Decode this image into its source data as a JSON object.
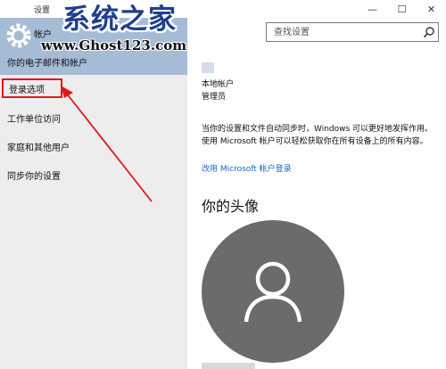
{
  "window": {
    "title": "设置",
    "controls": {
      "minimize": "—",
      "maximize": "☐",
      "close": "✕"
    }
  },
  "header": {
    "page_title": "帐户",
    "gear_icon": "gear-icon"
  },
  "watermark": {
    "title": "系统之家",
    "url": "www.Ghost123.com"
  },
  "sidebar": {
    "items": [
      {
        "label": "你的电子邮件和帐户"
      },
      {
        "label": "登录选项"
      },
      {
        "label": "工作单位访问"
      },
      {
        "label": "家庭和其他用户"
      },
      {
        "label": "同步你的设置"
      }
    ]
  },
  "search": {
    "placeholder": "查找设置",
    "icon": "search-icon"
  },
  "account": {
    "type": "本地帐户",
    "role": "管理员"
  },
  "sync_info": "当你的设置和文件自动同步时，Windows 可以更好地发挥作用。使用 Microsoft 帐户可以轻松获取你在所有设备上的所有内容。",
  "ms_link": "改用 Microsoft 帐户登录",
  "avatar_section": {
    "heading": "你的头像",
    "icon": "user-icon"
  },
  "colors": {
    "header_bg": "#a6bbd6",
    "sidebar_bg": "#ededed",
    "highlight_border": "#e11919",
    "link": "#1a67c2",
    "avatar_bg": "#6b6b6b"
  }
}
